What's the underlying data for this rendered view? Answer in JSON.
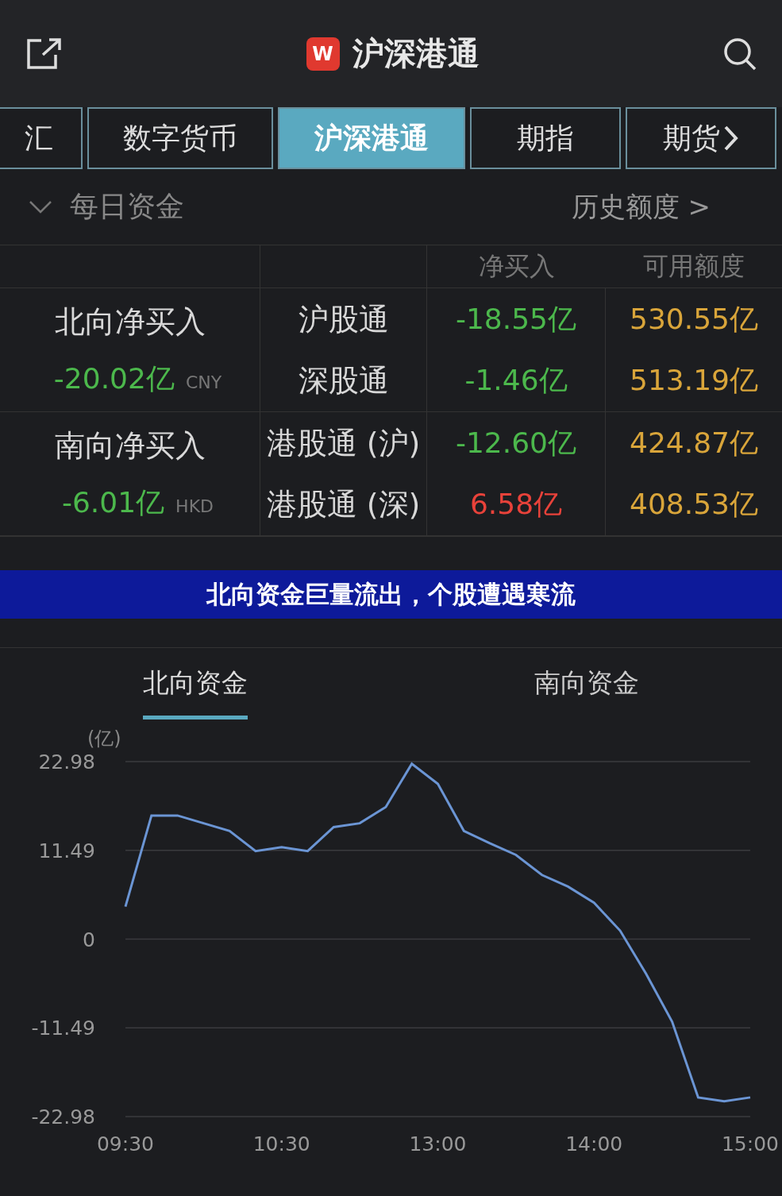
{
  "header": {
    "logo_text": "W",
    "title": "沪深港通"
  },
  "tabs": [
    {
      "label": "汇",
      "selected": false
    },
    {
      "label": "数字货币",
      "selected": false
    },
    {
      "label": "沪深港通",
      "selected": true
    },
    {
      "label": "期指",
      "selected": false
    },
    {
      "label": "期货",
      "selected": false
    }
  ],
  "daily_funds": {
    "title": "每日资金",
    "expanded": true,
    "history_link": "历史额度 >"
  },
  "table": {
    "columns": [
      "净买入",
      "可用额度"
    ],
    "groups": [
      {
        "label": "北向净买入",
        "total": "-20.02亿",
        "color": "#4cb84c",
        "currency": "CNY",
        "rows": [
          {
            "name": "沪股通",
            "net": "-18.55亿",
            "color": "#4cb84c",
            "quota": "530.55亿"
          },
          {
            "name": "深股通",
            "net": "-1.46亿",
            "color": "#4cb84c",
            "quota": "513.19亿"
          }
        ]
      },
      {
        "label": "南向净买入",
        "total": "-6.01亿",
        "color": "#4cb84c",
        "currency": "HKD",
        "rows": [
          {
            "name": "港股通 (沪)",
            "net": "-12.60亿",
            "color": "#4cb84c",
            "quota": "424.87亿"
          },
          {
            "name": "港股通 (深)",
            "net": "6.58亿",
            "color": "#e8423a",
            "quota": "408.53亿"
          }
        ]
      }
    ]
  },
  "banner": "北向资金巨量流出，个股遭遇寒流",
  "chart_tabs": [
    {
      "label": "北向资金",
      "selected": true
    },
    {
      "label": "南向资金",
      "selected": false
    }
  ],
  "chart": {
    "chart_data": {
      "type": "line",
      "ylabel": "(亿)",
      "categories": [
        "09:30",
        null,
        null,
        null,
        null,
        null,
        "10:30",
        null,
        null,
        null,
        null,
        null,
        "13:00",
        null,
        null,
        null,
        null,
        null,
        "14:00",
        null,
        null,
        null,
        null,
        null,
        "15:00"
      ],
      "series": [
        {
          "color": "#6b95d4",
          "values": [
            4.2,
            16.0,
            16.0,
            15.0,
            14.0,
            11.4,
            11.9,
            11.4,
            14.5,
            15.0,
            17.1,
            22.7,
            20.1,
            14.0,
            12.4,
            10.9,
            8.3,
            6.8,
            4.7,
            1.1,
            -4.5,
            -10.7,
            -20.5,
            -21.0,
            -20.5
          ]
        }
      ],
      "grid": true,
      "ylim": [
        -22.98,
        22.98
      ],
      "yticks": [
        {
          "value": 22.98,
          "label": "22.98"
        },
        {
          "value": 11.49,
          "label": "11.49"
        },
        {
          "value": 0,
          "label": "0"
        },
        {
          "value": -11.49,
          "label": "-11.49"
        },
        {
          "value": -22.98,
          "label": "-22.98"
        }
      ]
    }
  }
}
